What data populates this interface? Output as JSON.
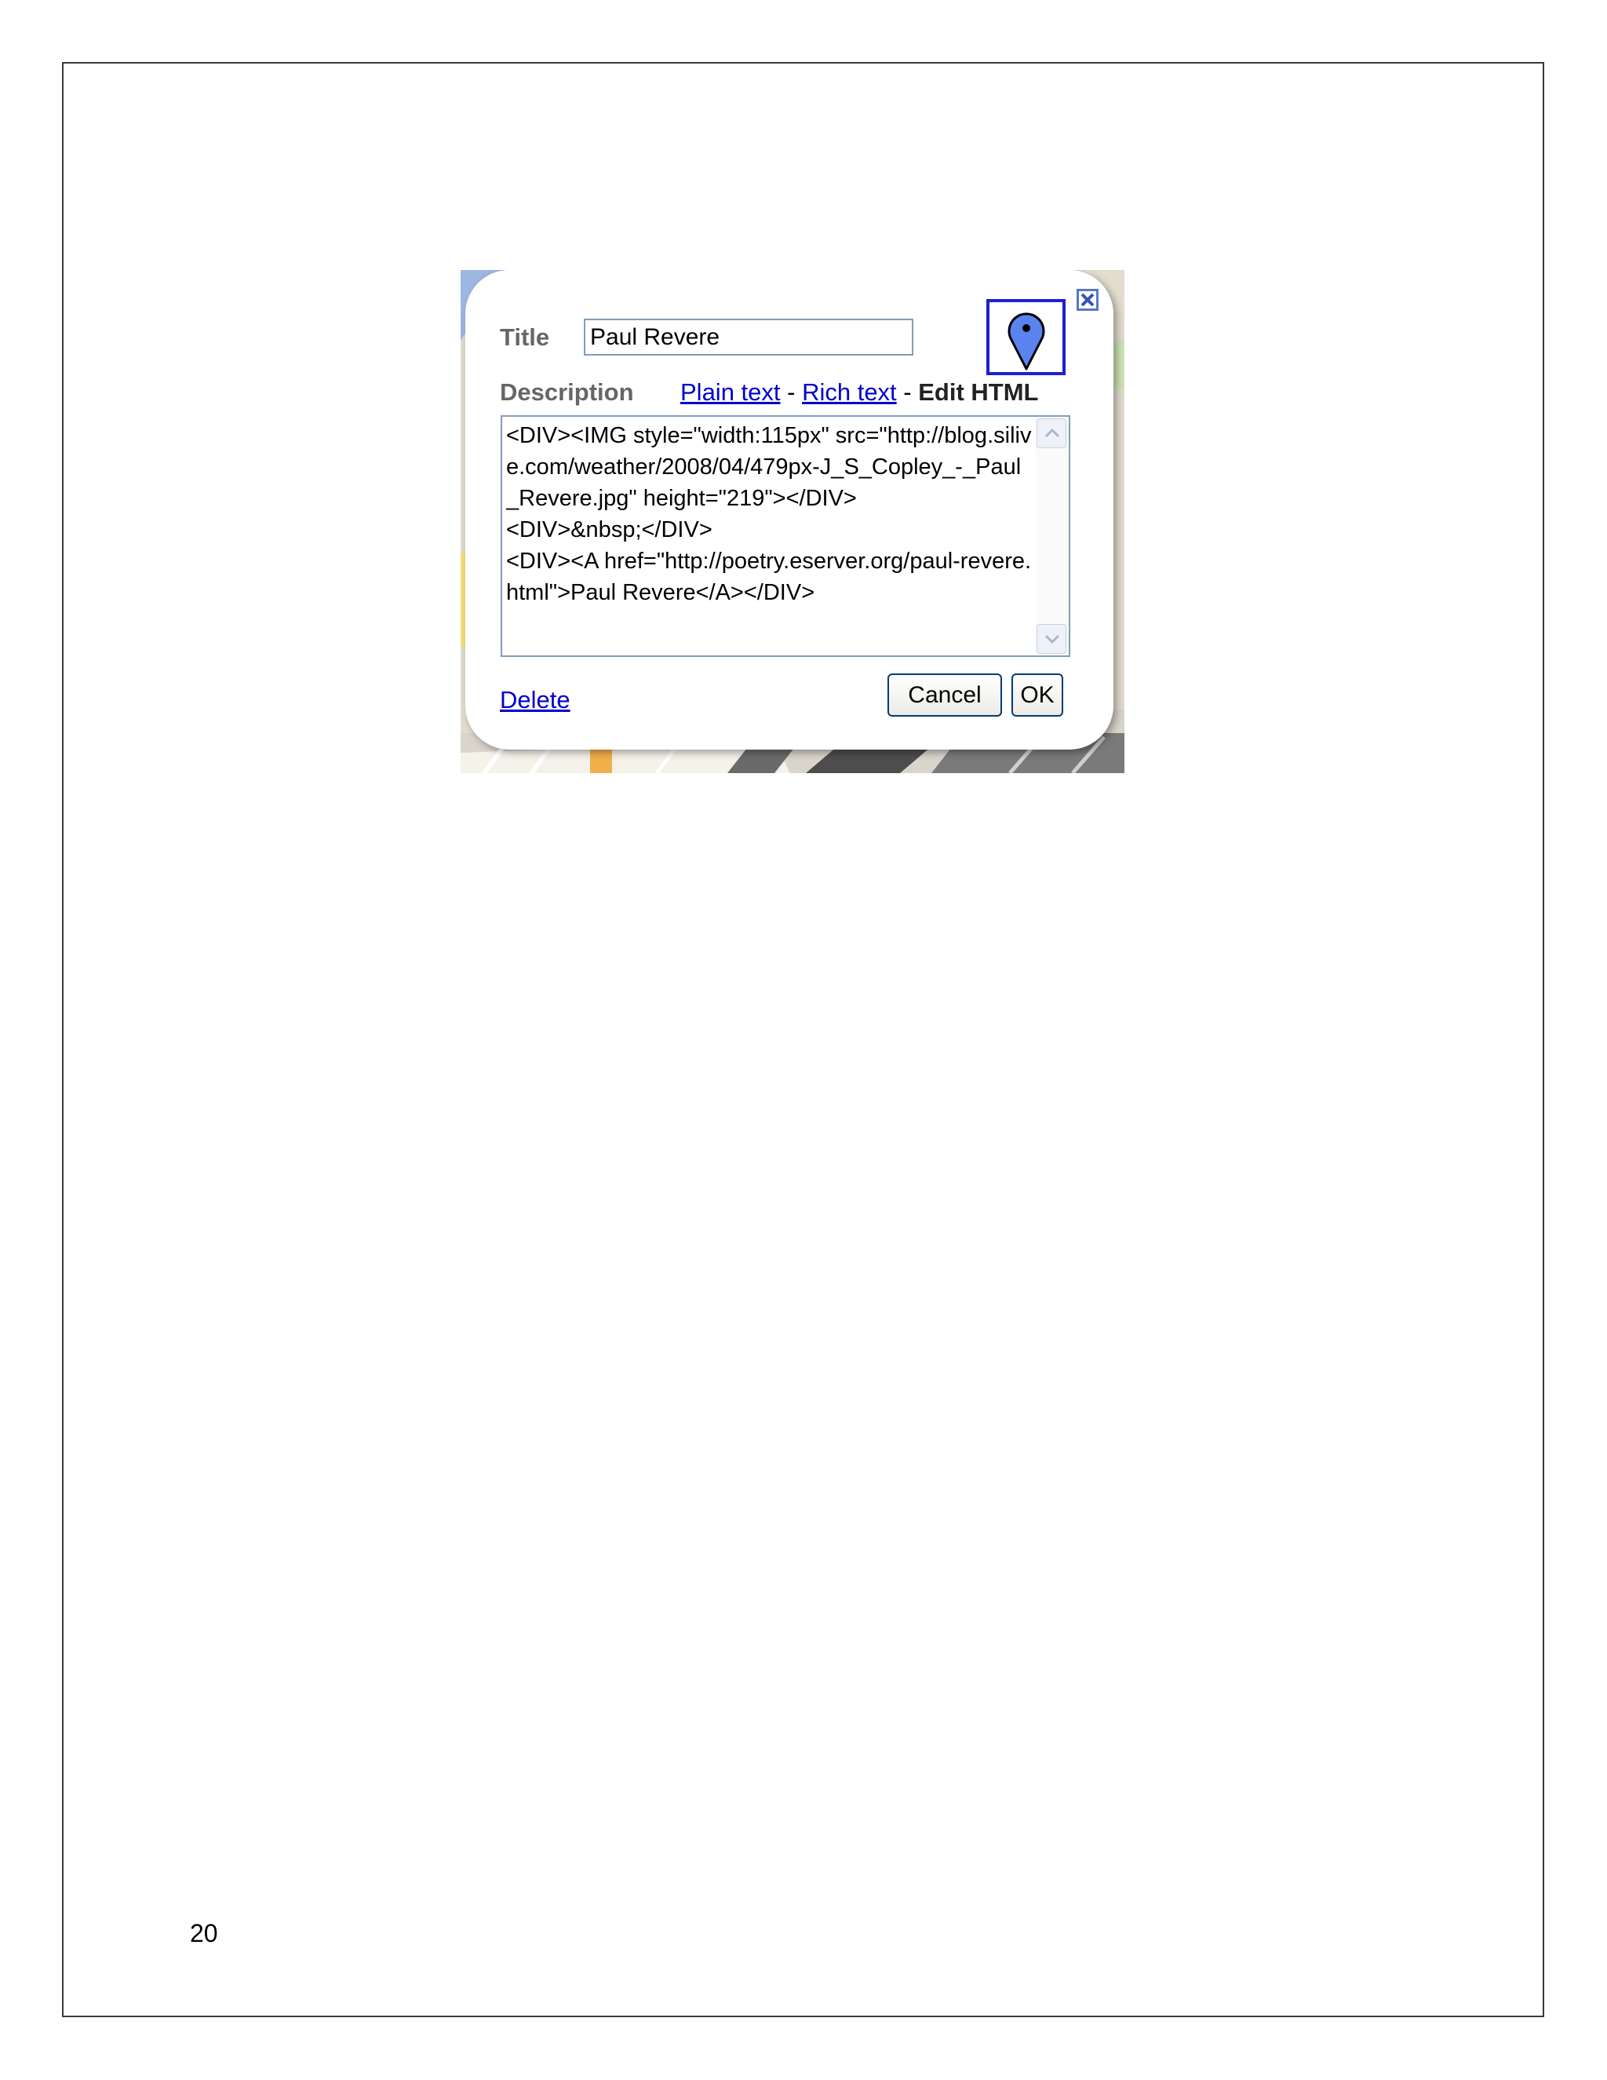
{
  "page": {
    "page_number": "20"
  },
  "dialog": {
    "title_label": "Title",
    "title_value": "Paul Revere",
    "description_label": "Description",
    "modes": {
      "plain_text": "Plain text",
      "separator": " - ",
      "rich_text": "Rich text",
      "edit_html": "Edit HTML"
    },
    "html_code": "<DIV><IMG style=\"width:115px\" src=\"http://blog.silive.com/weather/2008/04/479px-J_S_Copley_-_Paul_Revere.jpg\" height=\"219\"></DIV>\n<DIV>&nbsp;</DIV>\n<DIV><A href=\"http://poetry.eserver.org/paul-revere.html\">Paul Revere</A></DIV>",
    "delete_label": "Delete",
    "cancel_label": "Cancel",
    "ok_label": "OK"
  },
  "icons": {
    "close": "close-icon",
    "placemark": "map-pin-icon",
    "scroll_up": "chevron-up-icon",
    "scroll_down": "chevron-down-icon"
  },
  "colors": {
    "link": "#0000cc",
    "pin_fill": "#5b83f0",
    "pin_frame": "#1f1fd0"
  }
}
